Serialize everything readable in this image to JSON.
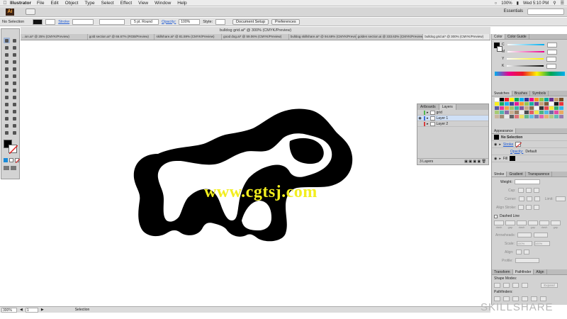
{
  "menubar": {
    "app_name": "Illustrator",
    "items": [
      "File",
      "Edit",
      "Object",
      "Type",
      "Select",
      "Effect",
      "View",
      "Window",
      "Help"
    ],
    "battery": "100%",
    "clock": "Wed 5:10 PM"
  },
  "appbar": {
    "logo": "Ai",
    "workspace": "Essentials"
  },
  "controlbar": {
    "selection": "No Selection",
    "stroke_label": "Stroke",
    "brush_value": "5 pt. Round",
    "opacity_label": "Opacity:",
    "opacity_value": "100%",
    "style_label": "Style:",
    "document_setup": "Document Setup",
    "preferences": "Preferences"
  },
  "document": {
    "title": "bulldog grid.ai* @ 300% (CMYK/Preview)",
    "tabs": [
      "...ion.ai* @ 25% (CMYK/Preview)",
      "gold section.ai* @ 66.67% (RGB/Preview)",
      "skillshare.ai* @ 81.59% (CMYK/Preview)",
      "good dog.ai* @ 59.06% (CMYK/Preview)",
      "bulldog skillshare.ai* @ 94.69% (CMYK/Preview)",
      "golden section.ai @ 333.63% (CMYK/Preview)",
      "bulldog grid.ai* @ 300% (CMYK/Preview)"
    ],
    "active_tab": 6
  },
  "canvas": {
    "watermark": "www.cgtsj.com",
    "brand": "SKILLSHARE"
  },
  "layers_panel": {
    "tabs": [
      "Artboards",
      "Layers"
    ],
    "layers": [
      {
        "name": "grid",
        "color": "#4fb84f"
      },
      {
        "name": "Layer 1",
        "color": "#3d6fd8"
      },
      {
        "name": "Layer 2",
        "color": "#d83d3d"
      }
    ],
    "count": "3 Layers"
  },
  "color_panel": {
    "tabs": [
      "Color",
      "Color Guide"
    ],
    "channels": [
      "C",
      "M",
      "Y",
      "K"
    ]
  },
  "swatches_panel": {
    "tabs": [
      "Swatches",
      "Brushes",
      "Symbols"
    ]
  },
  "appearance_panel": {
    "title": "Appearance",
    "selection": "No Selection",
    "stroke": "Stroke",
    "opacity": "Opacity:",
    "opacity_value": "Default",
    "fill": "Fill"
  },
  "stroke_panel": {
    "tabs": [
      "Stroke",
      "Gradient",
      "Transparence"
    ],
    "weight_label": "Weight:",
    "cap_label": "Cap:",
    "corner_label": "Corner:",
    "limit_label": "Limit:",
    "align_label": "Align Stroke:",
    "dashed_label": "Dashed Line",
    "dash_fields": [
      "dash",
      "gap",
      "dash",
      "gap",
      "dash",
      "gap"
    ],
    "arrowheads_label": "Arrowheads:",
    "scale_label": "Scale:",
    "scale_value": "100%",
    "align2_label": "Align:",
    "profile_label": "Profile:"
  },
  "pathfinder_panel": {
    "tabs": [
      "Transform",
      "Pathfinder",
      "Align"
    ],
    "shape_modes": "Shape Modes:",
    "pathfinders": "Pathfinders:",
    "expand": "Expand"
  },
  "statusbar": {
    "zoom": "300%",
    "artboard": "1",
    "tool": "Selection"
  }
}
